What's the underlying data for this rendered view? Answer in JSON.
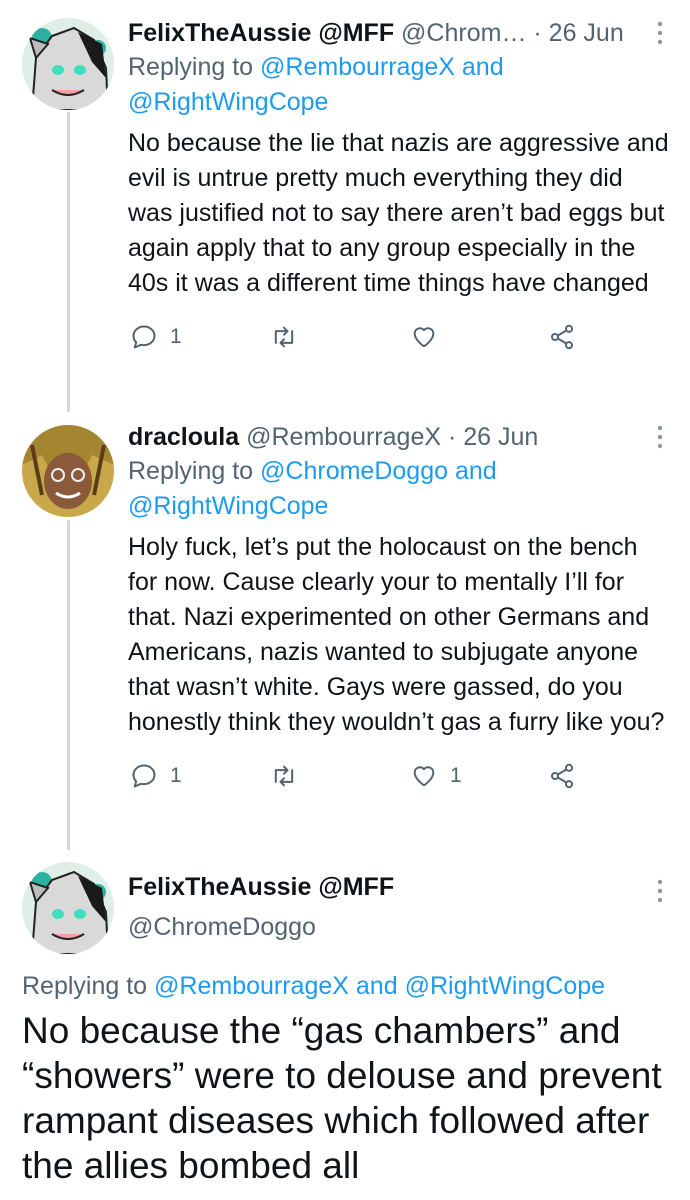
{
  "tweets": [
    {
      "display_name": "FelixTheAussie @MFF",
      "handle": "@Chrom…",
      "time": "· 26 Jun",
      "reply_prefix": "Replying to",
      "reply_handle_1": "@RembourrageX",
      "reply_and": "and",
      "reply_handle_2": "@RightWingCope",
      "text": "No because the lie that nazis are aggressive and evil is untrue pretty much everything they did was justified not to say there aren’t bad eggs but again apply that to any group especially in the 40s it was a different time things have changed",
      "reply_count": "1",
      "retweet_count": "",
      "like_count": ""
    },
    {
      "display_name": "dracloula",
      "handle": "@RembourrageX",
      "time": "· 26 Jun",
      "reply_prefix": "Replying to",
      "reply_handle_1": "@ChromeDoggo",
      "reply_and": "and",
      "reply_handle_2": "@RightWingCope",
      "text": "Holy fuck, let’s put the holocaust on the bench for now. Cause clearly your to mentally I’ll for that. Nazi experimented on other Germans and Americans, nazis wanted to subjugate anyone that wasn’t white. Gays were gassed, do you honestly think they wouldn’t gas a furry like you?",
      "reply_count": "1",
      "retweet_count": "",
      "like_count": "1"
    }
  ],
  "main_tweet": {
    "display_name": "FelixTheAussie @MFF",
    "handle": "@ChromeDoggo",
    "reply_prefix": "Replying to",
    "reply_handle_1": "@RembourrageX",
    "reply_and": "and",
    "reply_handle_2": "@RightWingCope",
    "text": "No because the “gas chambers” and “showers” were to delouse and prevent rampant diseases which followed after the allies bombed all"
  },
  "colors": {
    "accent": "#1d9bf0",
    "muted": "#536471",
    "text": "#0f1419",
    "thread_line": "#cfd9de"
  },
  "icons": [
    "reply-icon",
    "retweet-icon",
    "like-icon",
    "share-icon",
    "more-icon"
  ]
}
